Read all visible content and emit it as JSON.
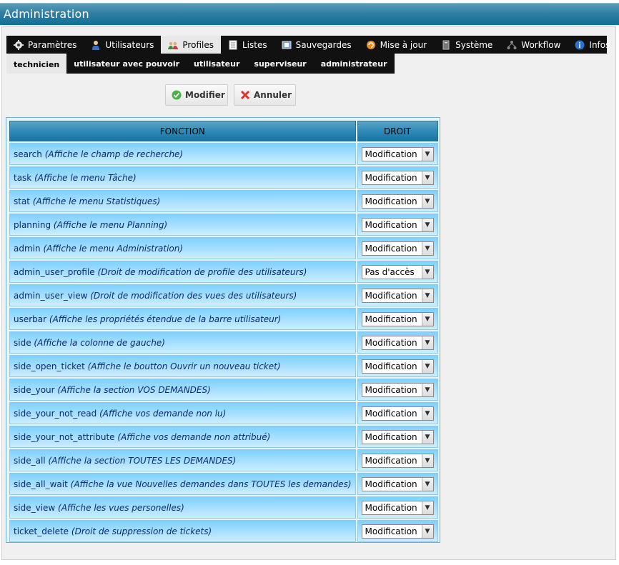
{
  "page_title": "Administration",
  "main_tabs": [
    {
      "label": "Paramètres",
      "icon": "gear-icon"
    },
    {
      "label": "Utilisateurs",
      "icon": "user-icon"
    },
    {
      "label": "Profiles",
      "icon": "users-icon"
    },
    {
      "label": "Listes",
      "icon": "list-icon"
    },
    {
      "label": "Sauvegardes",
      "icon": "backup-icon"
    },
    {
      "label": "Mise à jour",
      "icon": "update-icon"
    },
    {
      "label": "Système",
      "icon": "server-icon"
    },
    {
      "label": "Workflow",
      "icon": "workflow-icon"
    },
    {
      "label": "Infos",
      "icon": "info-icon"
    }
  ],
  "active_main_tab": "Profiles",
  "sub_tabs": [
    {
      "label": "technicien"
    },
    {
      "label": "utilisateur avec pouvoir"
    },
    {
      "label": "utilisateur"
    },
    {
      "label": "superviseur"
    },
    {
      "label": "administrateur"
    }
  ],
  "active_sub_tab": "technicien",
  "actions": {
    "modify": "Modifier",
    "cancel": "Annuler"
  },
  "table": {
    "headers": {
      "function": "FONCTION",
      "right": "DROIT"
    },
    "rows": [
      {
        "name": "search",
        "desc": "(Affiche le champ de recherche)",
        "value": "Modification"
      },
      {
        "name": "task",
        "desc": "(Affiche le menu Tâche)",
        "value": "Modification"
      },
      {
        "name": "stat",
        "desc": "(Affiche le menu Statistiques)",
        "value": "Modification"
      },
      {
        "name": "planning",
        "desc": "(Affiche le menu Planning)",
        "value": "Modification"
      },
      {
        "name": "admin",
        "desc": "(Affiche le menu Administration)",
        "value": "Modification"
      },
      {
        "name": "admin_user_profile",
        "desc": "(Droit de modification de profile des utilisateurs)",
        "value": "Pas d'accès"
      },
      {
        "name": "admin_user_view",
        "desc": "(Droit de modification des vues des utilisateurs)",
        "value": "Modification"
      },
      {
        "name": "userbar",
        "desc": "(Affiche les propriétés étendue de la barre utilisateur)",
        "value": "Modification"
      },
      {
        "name": "side",
        "desc": "(Affiche la colonne de gauche)",
        "value": "Modification"
      },
      {
        "name": "side_open_ticket",
        "desc": "(Affiche le boutton Ouvrir un nouveau ticket)",
        "value": "Modification"
      },
      {
        "name": "side_your",
        "desc": "(Affiche la section VOS DEMANDES)",
        "value": "Modification"
      },
      {
        "name": "side_your_not_read",
        "desc": "(Affiche vos demande non lu)",
        "value": "Modification"
      },
      {
        "name": "side_your_not_attribute",
        "desc": "(Affiche vos demande non attribué)",
        "value": "Modification"
      },
      {
        "name": "side_all",
        "desc": "(Affiche la section TOUTES LES DEMANDES)",
        "value": "Modification"
      },
      {
        "name": "side_all_wait",
        "desc": "(Affiche la vue Nouvelles demandes dans TOUTES les demandes)",
        "value": "Modification"
      },
      {
        "name": "side_view",
        "desc": "(Affiche les vues personelles)",
        "value": "Modification"
      },
      {
        "name": "ticket_delete",
        "desc": "(Droit de suppression de tickets)",
        "value": "Modification"
      }
    ]
  }
}
